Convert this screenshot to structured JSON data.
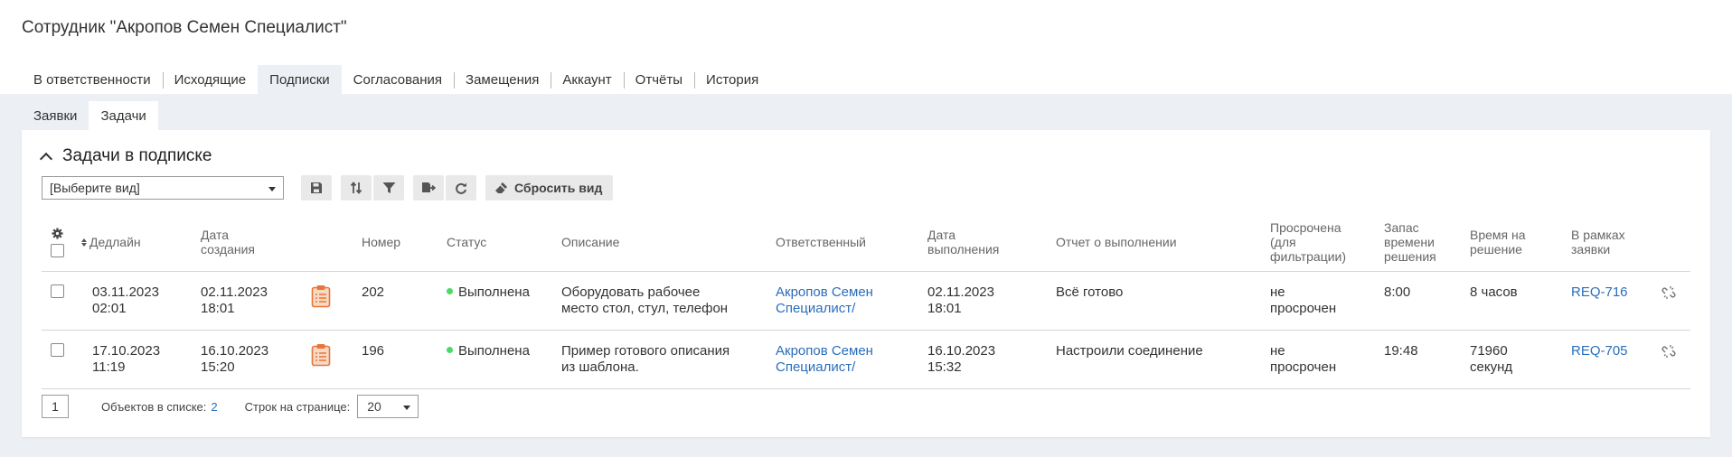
{
  "page": {
    "title": "Сотрудник \"Акропов Семен Специалист\""
  },
  "top_tabs": [
    {
      "label": "В ответственности",
      "active": false
    },
    {
      "label": "Исходящие",
      "active": false
    },
    {
      "label": "Подписки",
      "active": true
    },
    {
      "label": "Согласования",
      "active": false
    },
    {
      "label": "Замещения",
      "active": false
    },
    {
      "label": "Аккаунт",
      "active": false
    },
    {
      "label": "Отчёты",
      "active": false
    },
    {
      "label": "История",
      "active": false
    }
  ],
  "sub_tabs": [
    {
      "label": "Заявки",
      "active": false
    },
    {
      "label": "Задачи",
      "active": true
    }
  ],
  "panel": {
    "title": "Задачи в подписке"
  },
  "toolbar": {
    "view_select_value": "[Выберите вид]",
    "reset_label": "Сбросить вид",
    "icons": [
      "save-icon",
      "sort-icon",
      "filter-icon",
      "export-icon",
      "refresh-icon",
      "brush-icon"
    ]
  },
  "table": {
    "columns": {
      "deadline": "Дедлайн",
      "created": "Дата создания",
      "number": "Номер",
      "status": "Статус",
      "description": "Описание",
      "responsible": "Ответственный",
      "completed": "Дата выполнения",
      "report": "Отчет о выполнении",
      "overdue": "Просрочена (для фильтрации)",
      "reserve": "Запас времени решения",
      "solve_time": "Время на решение",
      "request": "В рамках заявки"
    },
    "rows": [
      {
        "deadline_date": "03.11.2023",
        "deadline_time": "02:01",
        "created_date": "02.11.2023",
        "created_time": "18:01",
        "number": "202",
        "status": "Выполнена",
        "desc_line1": "Оборудовать рабочее",
        "desc_line2": "место стол, стул, телефон",
        "resp_line1": "Акропов Семен",
        "resp_line2": "Специалист/",
        "completed_date": "02.11.2023",
        "completed_time": "18:01",
        "report": "Всё готово",
        "overdue_line1": "не",
        "overdue_line2": "просрочен",
        "reserve": "8:00",
        "solve_line1": "8 часов",
        "solve_line2": "",
        "request": "REQ-716"
      },
      {
        "deadline_date": "17.10.2023",
        "deadline_time": "11:19",
        "created_date": "16.10.2023",
        "created_time": "15:20",
        "number": "196",
        "status": "Выполнена",
        "desc_line1": "Пример готового описания",
        "desc_line2": "из шаблона.",
        "resp_line1": "Акропов Семен",
        "resp_line2": "Специалист/",
        "completed_date": "16.10.2023",
        "completed_time": "15:32",
        "report": "Настроили соединение",
        "overdue_line1": "не",
        "overdue_line2": "просрочен",
        "reserve": "19:48",
        "solve_line1": "71960",
        "solve_line2": "секунд",
        "request": "REQ-705"
      }
    ]
  },
  "footer": {
    "page": "1",
    "objects_label": "Объектов в списке:",
    "objects_count": "2",
    "rows_label": "Строк на странице:",
    "rows_value": "20"
  },
  "colors": {
    "link": "#2a6ebb",
    "status_done": "#4cd964",
    "background": "#ecf0f5",
    "task_icon": "#e8763a"
  }
}
